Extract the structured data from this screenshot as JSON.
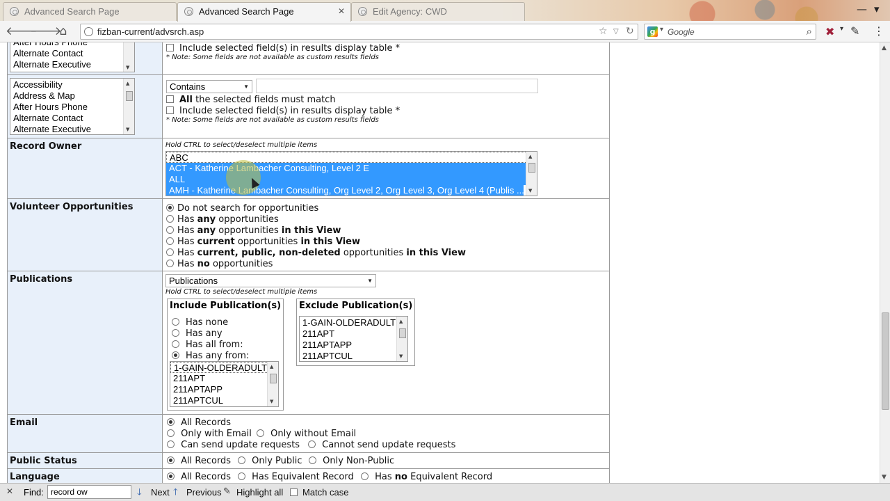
{
  "browser": {
    "tabs": [
      {
        "label": "Advanced Search Page",
        "active": false
      },
      {
        "label": "Advanced Search Page",
        "active": true
      },
      {
        "label": "Edit Agency: CWD",
        "active": false
      }
    ],
    "url": "fizban-current/advsrch.asp",
    "search_placeholder": "Google"
  },
  "top_partial": {
    "list_items": [
      "After Hours Phone",
      "Alternate Contact",
      "Alternate Executive"
    ],
    "include_label": "Include selected field(s) in results display table *",
    "note": "* Note: Some fields are not available as custom results fields"
  },
  "custom_field": {
    "list_items": [
      "Accessibility",
      "Address & Map",
      "After Hours Phone",
      "Alternate Contact",
      "Alternate Executive"
    ],
    "match_select": "Contains",
    "all_match_bold": "All",
    "all_match_rest": " the selected fields must match",
    "include_label": "Include selected field(s) in results display table *",
    "note": "* Note: Some fields are not available as custom results fields"
  },
  "record_owner": {
    "label": "Record Owner",
    "hint": "Hold CTRL to select/deselect multiple items",
    "items": [
      {
        "text": "ABC",
        "selected": false
      },
      {
        "text": "ACT - Katherine Lambacher Consulting, Level 2 E",
        "selected": true
      },
      {
        "text": "ALL",
        "selected": true
      },
      {
        "text": "AMH - Katherine Lambacher Consulting, Org Level 2, Org Level 3, Org Level 4 (Publis ...",
        "selected": true
      }
    ]
  },
  "volunteer": {
    "label": "Volunteer Opportunities",
    "options": [
      {
        "a": "Do not search for opportunities",
        "b": "",
        "c": "",
        "d": "",
        "checked": true
      },
      {
        "a": "Has ",
        "b": "any",
        "c": " opportunities",
        "d": "",
        "checked": false
      },
      {
        "a": "Has ",
        "b": "any",
        "c": " opportunities ",
        "d": "in this View",
        "checked": false
      },
      {
        "a": "Has ",
        "b": "current",
        "c": " opportunities ",
        "d": "in this View",
        "checked": false
      },
      {
        "a": "Has ",
        "b": "current, public, non-deleted",
        "c": " opportunities ",
        "d": "in this View",
        "checked": false
      },
      {
        "a": "Has ",
        "b": "no",
        "c": " opportunities",
        "d": "",
        "checked": false
      }
    ]
  },
  "publications": {
    "label": "Publications",
    "select": "Publications",
    "hint": "Hold CTRL to select/deselect multiple items",
    "include_title": "Include Publication(s)",
    "exclude_title": "Exclude Publication(s)",
    "include_options": [
      {
        "text": "Has none",
        "checked": false
      },
      {
        "text": "Has any",
        "checked": false
      },
      {
        "text": "Has all from:",
        "checked": false
      },
      {
        "text": "Has any from:",
        "checked": true
      }
    ],
    "codes": [
      "1-GAIN-OLDERADULT",
      "211APT",
      "211APTAPP",
      "211APTCUL"
    ]
  },
  "email": {
    "label": "Email",
    "options": [
      "All Records",
      "Only with Email",
      "Only without Email",
      "Can send update requests",
      "Cannot send update requests"
    ],
    "selected": 0
  },
  "public_status": {
    "label": "Public Status",
    "options": [
      "All Records",
      "Only Public",
      "Only Non-Public"
    ],
    "selected": 0
  },
  "language": {
    "label": "Language",
    "options": [
      "All Records",
      "Has Equivalent Record",
      "Has "
    ],
    "no_word": "no",
    "last_rest": " Equivalent Record",
    "selected": 0
  },
  "findbar": {
    "label": "Find:",
    "query": "record ow",
    "next": "Next",
    "previous": "Previous",
    "highlight": "Highlight all",
    "match_case": "Match case"
  }
}
